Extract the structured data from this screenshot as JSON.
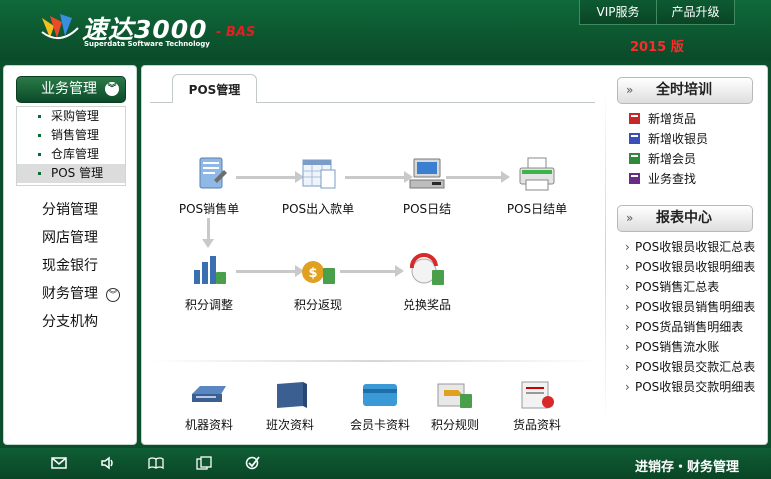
{
  "header": {
    "logo_main": "速达3000",
    "logo_suffix": "- BAS",
    "logo_sub": "Superdata Software Technology",
    "top_links": [
      "VIP服务",
      "产品升级"
    ],
    "year_label": "2015 版"
  },
  "sidebar": {
    "active_group": "业务管理",
    "sub_items": [
      "采购管理",
      "销售管理",
      "仓库管理",
      "POS 管理"
    ],
    "active_sub": "POS 管理",
    "items": [
      "分销管理",
      "网店管理",
      "现金银行",
      "财务管理",
      "分支机构"
    ]
  },
  "tab": {
    "label": "POS管理"
  },
  "flow": {
    "row1": [
      "POS销售单",
      "POS出入款单",
      "POS日结",
      "POS日结单"
    ],
    "row2": [
      "积分调整",
      "积分返现",
      "兑换奖品"
    ]
  },
  "bottom_items": [
    "机器资料",
    "班次资料",
    "会员卡资料",
    "积分规则",
    "货品资料"
  ],
  "training": {
    "title": "全时培训",
    "items": [
      "新增货品",
      "新增收银员",
      "新增会员",
      "业务查找"
    ]
  },
  "reports": {
    "title": "报表中心",
    "items": [
      "POS收银员收银汇总表",
      "POS收银员收银明细表",
      "POS销售汇总表",
      "POS收银员销售明细表",
      "POS货品销售明细表",
      "POS销售流水账",
      "POS收银员交款汇总表",
      "POS收银员交款明细表"
    ]
  },
  "footer": {
    "text": "进销存・财务管理"
  },
  "colors": {
    "brand_green": "#0b4a29",
    "accent_red": "#ff2a2a"
  }
}
